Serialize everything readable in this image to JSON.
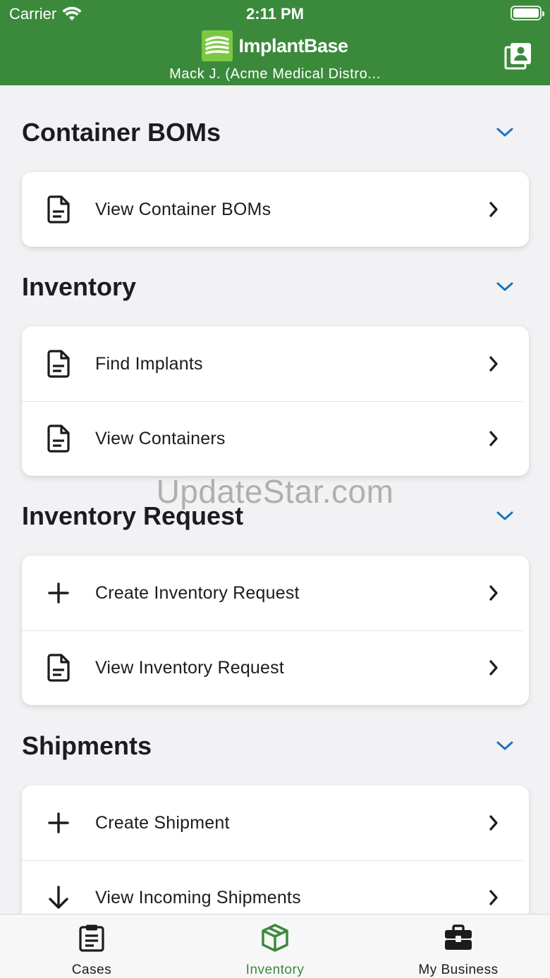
{
  "status_bar": {
    "carrier": "Carrier",
    "time": "2:11 PM",
    "wifi_icon": "wifi-icon",
    "battery_icon": "battery-icon"
  },
  "header": {
    "brand_name": "ImplantBase",
    "user": "Mack J. (Acme Medical Distro...",
    "action_icon": "contacts-book-icon",
    "colors": {
      "background": "#3b8a3c",
      "logo": "#7ac943"
    }
  },
  "sections": [
    {
      "title": "Container BOMs",
      "items": [
        {
          "label": "View Container BOMs",
          "icon": "document-icon"
        }
      ]
    },
    {
      "title": "Inventory",
      "items": [
        {
          "label": "Find Implants",
          "icon": "document-icon"
        },
        {
          "label": "View Containers",
          "icon": "document-icon"
        }
      ]
    },
    {
      "title": "Inventory Request",
      "items": [
        {
          "label": "Create Inventory Request",
          "icon": "plus-icon"
        },
        {
          "label": "View Inventory Request",
          "icon": "document-icon"
        }
      ]
    },
    {
      "title": "Shipments",
      "items": [
        {
          "label": "Create Shipment",
          "icon": "plus-icon"
        },
        {
          "label": "View Incoming Shipments",
          "icon": "arrow-down-icon"
        }
      ]
    }
  ],
  "watermark": "UpdateStar.com",
  "tabbar": {
    "tabs": [
      {
        "label": "Cases",
        "icon": "clipboard-icon",
        "active": false
      },
      {
        "label": "Inventory",
        "icon": "box-icon",
        "active": true
      },
      {
        "label": "My Business",
        "icon": "briefcase-icon",
        "active": false
      }
    ],
    "colors": {
      "active": "#3b8a3c",
      "accent_chevron": "#1a73c7"
    }
  }
}
